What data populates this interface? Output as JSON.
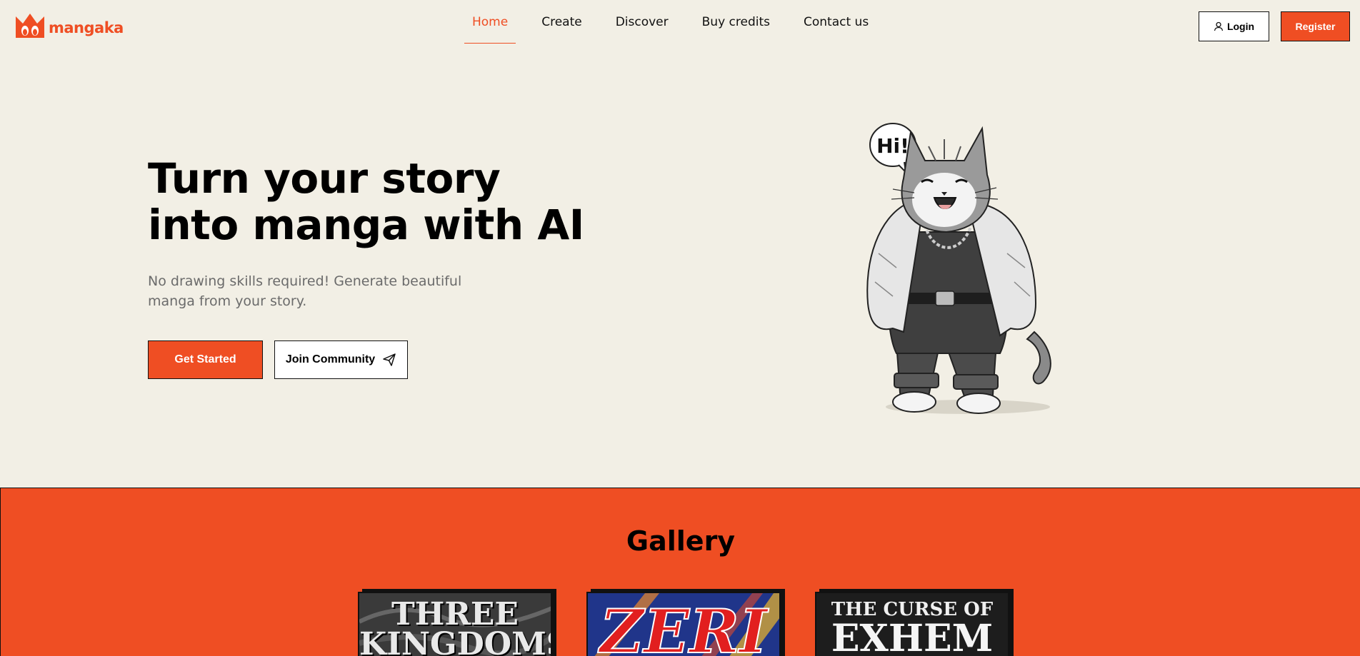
{
  "brand": {
    "name": "mangaka",
    "accent": "#ef4e23"
  },
  "nav": {
    "items": [
      {
        "label": "Home",
        "active": true
      },
      {
        "label": "Create"
      },
      {
        "label": "Discover"
      },
      {
        "label": "Buy credits"
      },
      {
        "label": "Contact us"
      }
    ]
  },
  "auth": {
    "login_label": "Login",
    "register_label": "Register"
  },
  "hero": {
    "title_line1": "Turn your story",
    "title_line2": "into manga with AI",
    "subtitle_line1": "No drawing skills required! Generate beautiful",
    "subtitle_line2": "manga from your story.",
    "primary_cta": "Get Started",
    "secondary_cta": "Join Community",
    "speech_bubble": "Hi!"
  },
  "gallery": {
    "title": "Gallery",
    "cards": [
      {
        "title_line1": "THREE",
        "title_line2": "KINGDOMS"
      },
      {
        "title_line1": "ZERI"
      },
      {
        "title_line1": "THE CURSE OF",
        "title_line2": "EXHEM"
      }
    ]
  }
}
